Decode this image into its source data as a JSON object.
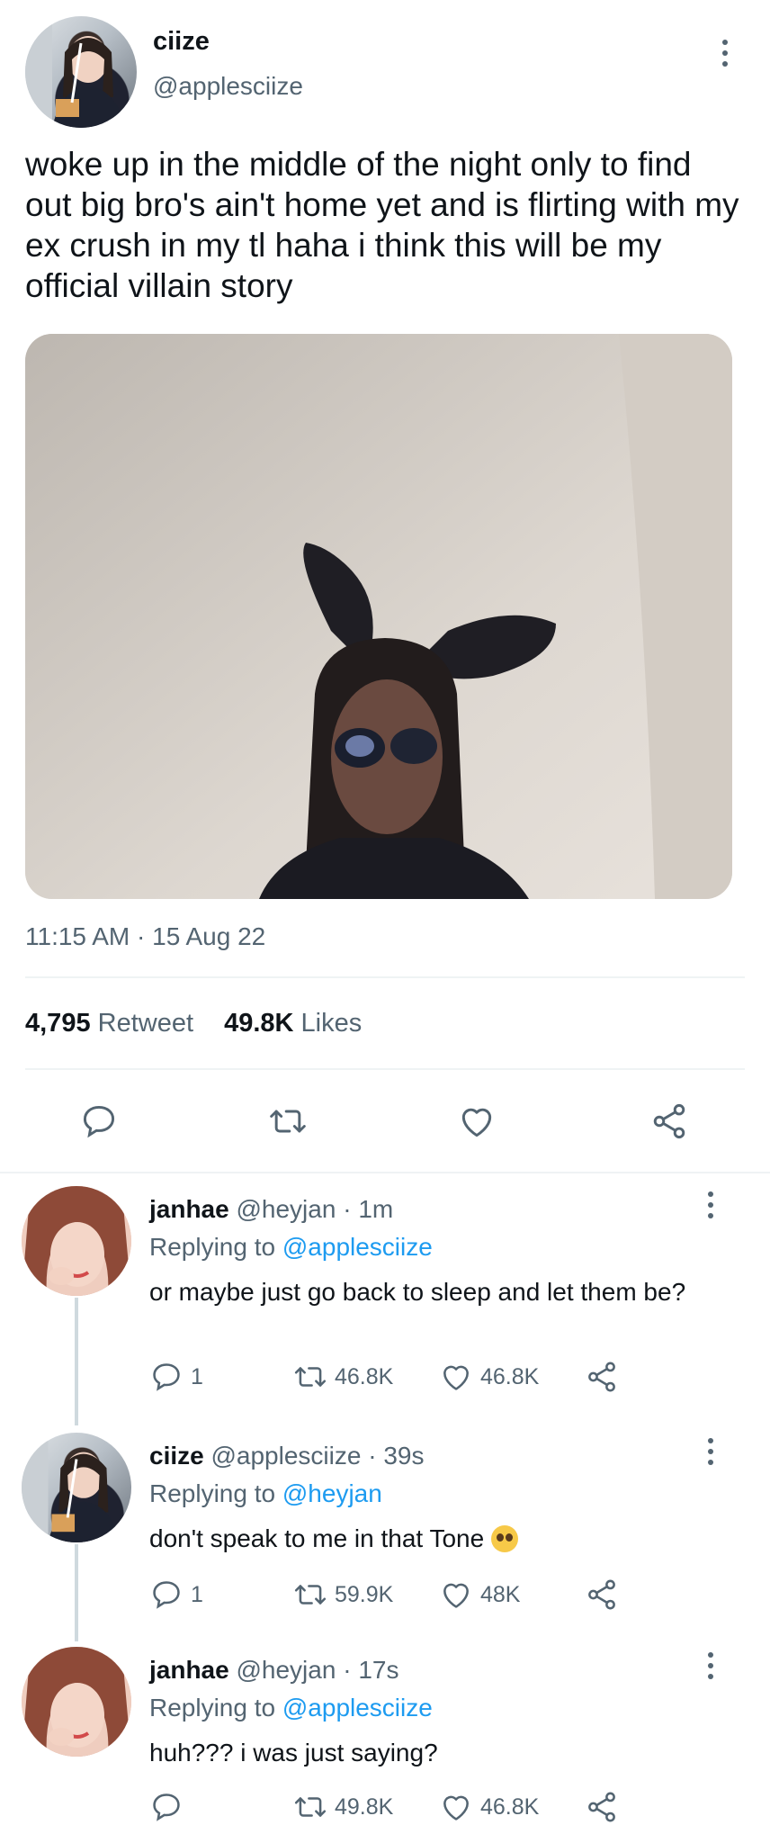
{
  "main_tweet": {
    "display_name": "ciize",
    "handle": "@applesciize",
    "text": "woke up in the middle of the night only to find out big bro's ain't home yet and is flirting with my ex crush in my tl haha i think this will be my official villain story",
    "time": "11:15 AM",
    "date_sep": "·",
    "date": "15 Aug 22",
    "retweets_count": "4,795",
    "retweets_label": "Retweet",
    "likes_count": "49.8K",
    "likes_label": "Likes"
  },
  "replies": [
    {
      "display_name": "janhae",
      "handle": "@heyjan",
      "sep": "·",
      "age": "1m",
      "replying_prefix": "Replying to",
      "replying_to": "@applesciize",
      "text": "or maybe just go back to sleep and let them be?",
      "replies": "1",
      "retweets": "46.8K",
      "likes": "46.8K"
    },
    {
      "display_name": "ciize",
      "handle": "@applesciize",
      "sep": "·",
      "age": "39s",
      "replying_prefix": "Replying to",
      "replying_to": "@heyjan",
      "text": "don't speak to me in that Tone",
      "emoji": "pleading-face-emoji",
      "replies": "1",
      "retweets": "59.9K",
      "likes": "48K"
    },
    {
      "display_name": "janhae",
      "handle": "@heyjan",
      "sep": "·",
      "age": "17s",
      "replying_prefix": "Replying to",
      "replying_to": "@applesciize",
      "text": "huh??? i was just saying?",
      "replies": "",
      "retweets": "49.8K",
      "likes": "46.8K"
    }
  ],
  "colors": {
    "text": "#0f1419",
    "muted": "#536471",
    "link": "#1d9bf0",
    "divider": "#eff3f4"
  },
  "icons": {
    "reply": "speech-bubble-icon",
    "retweet": "retweet-arrows-icon",
    "like": "heart-icon",
    "share": "share-nodes-icon",
    "more": "vertical-ellipsis-icon"
  }
}
